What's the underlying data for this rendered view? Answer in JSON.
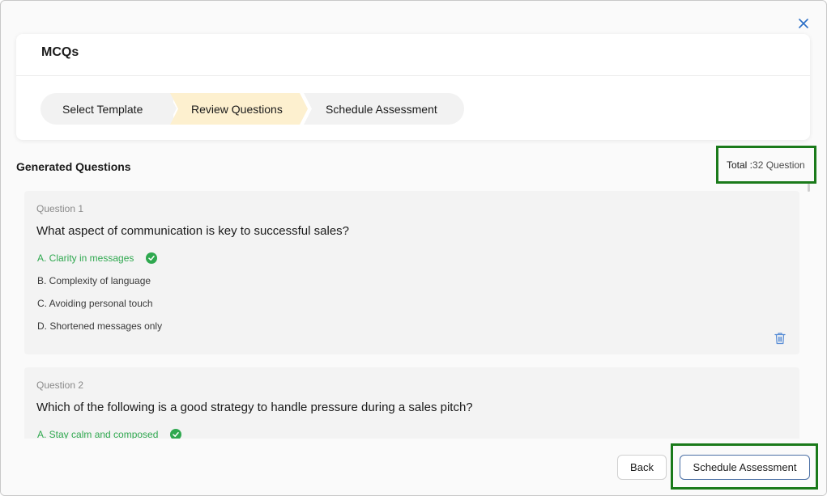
{
  "modal": {
    "title": "MCQs",
    "close_icon": "close-icon"
  },
  "stepper": {
    "steps": [
      {
        "label": "Select Template",
        "state": "done"
      },
      {
        "label": "Review Questions",
        "state": "active"
      },
      {
        "label": "Schedule Assessment",
        "state": "upcoming"
      }
    ]
  },
  "section": {
    "title": "Generated Questions",
    "total_label": "Total :",
    "total_value": "32 Question"
  },
  "questions": [
    {
      "number": "Question 1",
      "text": "What aspect of communication is key to successful sales?",
      "options": [
        {
          "text": "A. Clarity in messages",
          "correct": true
        },
        {
          "text": "B. Complexity of language",
          "correct": false
        },
        {
          "text": "C. Avoiding personal touch",
          "correct": false
        },
        {
          "text": "D. Shortened messages only",
          "correct": false
        }
      ]
    },
    {
      "number": "Question 2",
      "text": "Which of the following is a good strategy to handle pressure during a sales pitch?",
      "options": [
        {
          "text": "A. Stay calm and composed",
          "correct": true
        }
      ]
    }
  ],
  "footer": {
    "back_label": "Back",
    "schedule_label": "Schedule Assessment"
  },
  "colors": {
    "correct": "#2fa84f",
    "active_step": "#fdf0cf",
    "highlight_outline": "#1a7a1a"
  }
}
